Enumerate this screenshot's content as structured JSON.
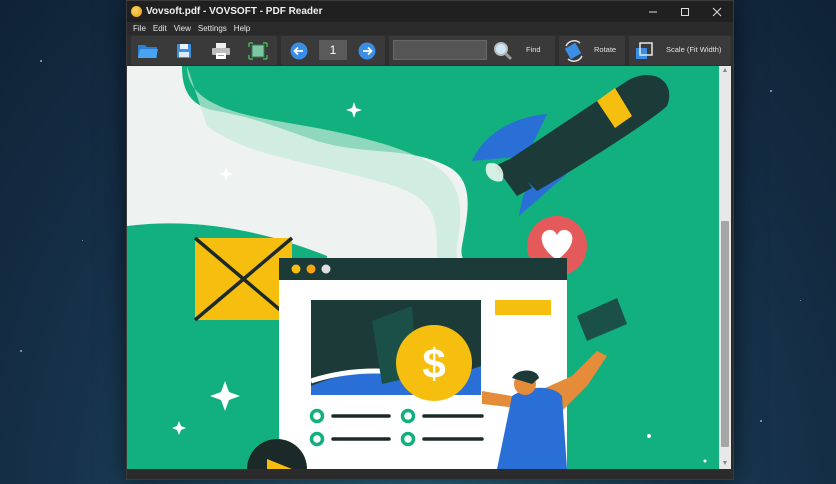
{
  "window": {
    "title": "Vovsoft.pdf - VOVSOFT - PDF Reader",
    "controls": [
      "minimize",
      "maximize",
      "close"
    ]
  },
  "menu": {
    "items": [
      "File",
      "Edit",
      "View",
      "Settings",
      "Help"
    ]
  },
  "toolbar": {
    "open_icon": "folder-open-icon",
    "save_icon": "save-icon",
    "print_icon": "printer-icon",
    "fit_icon": "fit-page-icon",
    "prev_icon": "arrow-left-icon",
    "next_icon": "arrow-right-icon",
    "page_number": "1",
    "search_value": "",
    "find_label": "Find",
    "rotate_label": "Rotate",
    "scale_label": "Scale (Fit Width)"
  },
  "document": {
    "illustration": "marketing-illustration",
    "price_symbol": "$"
  },
  "colors": {
    "page_green": "#12b07e",
    "accent_yellow": "#f6bf0f",
    "nav_blue": "#3a8ee6",
    "rocket_dark": "#1b3a38",
    "heart_red": "#e45a5a"
  }
}
